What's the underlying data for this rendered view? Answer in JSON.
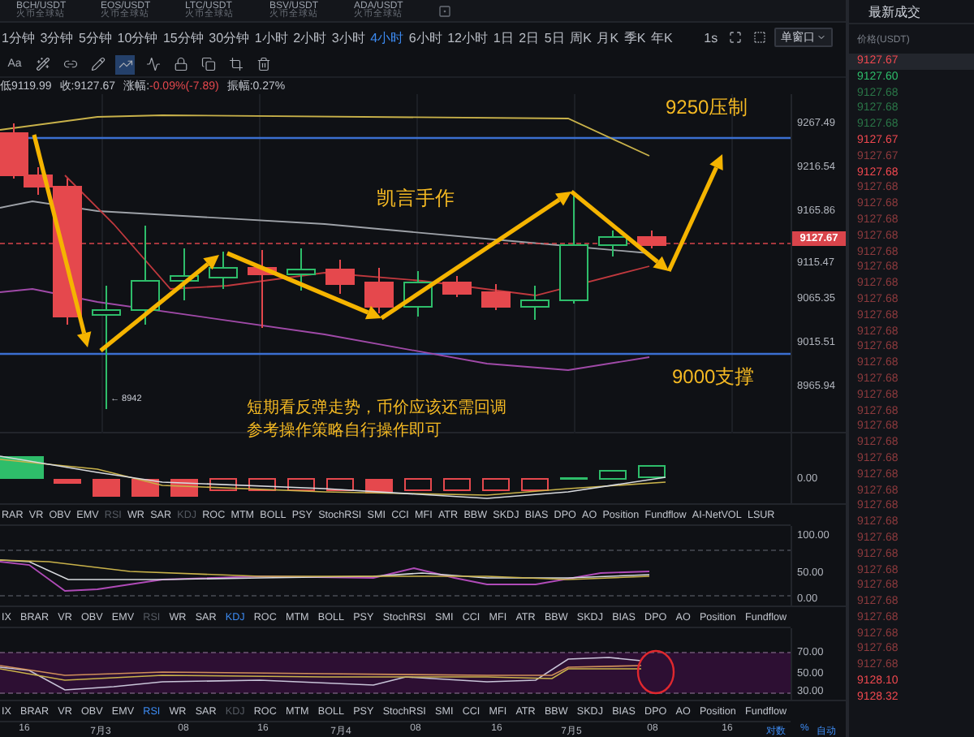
{
  "symbol_tabs": [
    {
      "pair": "BCH/USDT",
      "exchange": "火币全球站"
    },
    {
      "pair": "EOS/USDT",
      "exchange": "火币全球站"
    },
    {
      "pair": "LTC/USDT",
      "exchange": "火币全球站"
    },
    {
      "pair": "BSV/USDT",
      "exchange": "火币全球站"
    },
    {
      "pair": "ADA/USDT",
      "exchange": "火币全球站"
    }
  ],
  "intervals": [
    {
      "label": "1分钟",
      "selected": false
    },
    {
      "label": "3分钟",
      "selected": false
    },
    {
      "label": "5分钟",
      "selected": false
    },
    {
      "label": "10分钟",
      "selected": false
    },
    {
      "label": "15分钟",
      "selected": false
    },
    {
      "label": "30分钟",
      "selected": false
    },
    {
      "label": "1小时",
      "selected": false
    },
    {
      "label": "2小时",
      "selected": false
    },
    {
      "label": "3小时",
      "selected": false
    },
    {
      "label": "4小时",
      "selected": true
    },
    {
      "label": "6小时",
      "selected": false
    },
    {
      "label": "12小时",
      "selected": false
    },
    {
      "label": "1日",
      "selected": false
    },
    {
      "label": "2日",
      "selected": false
    },
    {
      "label": "5日",
      "selected": false
    },
    {
      "label": "周K",
      "selected": false
    },
    {
      "label": "月K",
      "selected": false
    },
    {
      "label": "季K",
      "selected": false
    },
    {
      "label": "年K",
      "selected": false
    }
  ],
  "chart_controls": {
    "tick_label": "1s",
    "window_mode": "单窗口"
  },
  "drawing_tools": [
    {
      "kind": "text",
      "label": "Aa",
      "selected": false
    },
    {
      "kind": "magic",
      "selected": false
    },
    {
      "kind": "link",
      "selected": false
    },
    {
      "kind": "pencil",
      "selected": false
    },
    {
      "kind": "trendline",
      "selected": true
    },
    {
      "kind": "wave",
      "selected": false
    },
    {
      "kind": "lock",
      "selected": false
    },
    {
      "kind": "copy",
      "selected": false
    },
    {
      "kind": "crop",
      "selected": false
    },
    {
      "kind": "trash",
      "selected": false
    }
  ],
  "ohlc_info": [
    {
      "label": "低",
      "value": "9119.99",
      "falling": false
    },
    {
      "label": "收:",
      "value": "9127.67",
      "falling": false
    },
    {
      "label": "涨幅:",
      "value": "-0.09%(-7.89)",
      "falling": true
    },
    {
      "label": "振幅:",
      "value": "0.27%",
      "falling": false
    }
  ],
  "main_chart": {
    "price_labels": [
      "9267.49",
      "9216.54",
      "9165.86",
      "9115.47",
      "9065.35",
      "9015.51",
      "8965.94"
    ],
    "current_price": "9127.67",
    "low_marker": "← 8942",
    "annotations": [
      {
        "kind": "resistance",
        "text": "9250压制"
      },
      {
        "kind": "author",
        "text": "凯言手作"
      },
      {
        "kind": "support",
        "text": "9000支撑"
      },
      {
        "kind": "note",
        "text": "短期看反弹走势，币价应该还需回调"
      },
      {
        "kind": "note",
        "text": "参考操作策略自行操作即可"
      }
    ]
  },
  "volume_panel": {
    "axis_labels": [
      "0.00"
    ]
  },
  "indicator_rows": [
    {
      "items": [
        {
          "label": "RAR",
          "selected": false,
          "muted": false
        },
        {
          "label": "VR",
          "selected": false,
          "muted": false
        },
        {
          "label": "OBV",
          "selected": false,
          "muted": false
        },
        {
          "label": "EMV",
          "selected": false,
          "muted": false
        },
        {
          "label": "RSI",
          "selected": false,
          "muted": true
        },
        {
          "label": "WR",
          "selected": false,
          "muted": false
        },
        {
          "label": "SAR",
          "selected": false,
          "muted": false
        },
        {
          "label": "KDJ",
          "selected": false,
          "muted": true
        },
        {
          "label": "ROC",
          "selected": false,
          "muted": false
        },
        {
          "label": "MTM",
          "selected": false,
          "muted": false
        },
        {
          "label": "BOLL",
          "selected": false,
          "muted": false
        },
        {
          "label": "PSY",
          "selected": false,
          "muted": false
        },
        {
          "label": "StochRSI",
          "selected": false,
          "muted": false
        },
        {
          "label": "SMI",
          "selected": false,
          "muted": false
        },
        {
          "label": "CCI",
          "selected": false,
          "muted": false
        },
        {
          "label": "MFI",
          "selected": false,
          "muted": false
        },
        {
          "label": "ATR",
          "selected": false,
          "muted": false
        },
        {
          "label": "BBW",
          "selected": false,
          "muted": false
        },
        {
          "label": "SKDJ",
          "selected": false,
          "muted": false
        },
        {
          "label": "BIAS",
          "selected": false,
          "muted": false
        },
        {
          "label": "DPO",
          "selected": false,
          "muted": false
        },
        {
          "label": "AO",
          "selected": false,
          "muted": false
        },
        {
          "label": "Position",
          "selected": false,
          "muted": false
        },
        {
          "label": "Fundflow",
          "selected": false,
          "muted": false
        },
        {
          "label": "AI-NetVOL",
          "selected": false,
          "muted": false
        },
        {
          "label": "LSUR",
          "selected": false,
          "muted": false
        }
      ]
    },
    {
      "items": [
        {
          "label": "IX",
          "selected": false,
          "muted": false
        },
        {
          "label": "BRAR",
          "selected": false,
          "muted": false
        },
        {
          "label": "VR",
          "selected": false,
          "muted": false
        },
        {
          "label": "OBV",
          "selected": false,
          "muted": false
        },
        {
          "label": "EMV",
          "selected": false,
          "muted": false
        },
        {
          "label": "RSI",
          "selected": false,
          "muted": true
        },
        {
          "label": "WR",
          "selected": false,
          "muted": false
        },
        {
          "label": "SAR",
          "selected": false,
          "muted": false
        },
        {
          "label": "KDJ",
          "selected": true,
          "muted": false
        },
        {
          "label": "ROC",
          "selected": false,
          "muted": false
        },
        {
          "label": "MTM",
          "selected": false,
          "muted": false
        },
        {
          "label": "BOLL",
          "selected": false,
          "muted": false
        },
        {
          "label": "PSY",
          "selected": false,
          "muted": false
        },
        {
          "label": "StochRSI",
          "selected": false,
          "muted": false
        },
        {
          "label": "SMI",
          "selected": false,
          "muted": false
        },
        {
          "label": "CCI",
          "selected": false,
          "muted": false
        },
        {
          "label": "MFI",
          "selected": false,
          "muted": false
        },
        {
          "label": "ATR",
          "selected": false,
          "muted": false
        },
        {
          "label": "BBW",
          "selected": false,
          "muted": false
        },
        {
          "label": "SKDJ",
          "selected": false,
          "muted": false
        },
        {
          "label": "BIAS",
          "selected": false,
          "muted": false
        },
        {
          "label": "DPO",
          "selected": false,
          "muted": false
        },
        {
          "label": "AO",
          "selected": false,
          "muted": false
        },
        {
          "label": "Position",
          "selected": false,
          "muted": false
        },
        {
          "label": "Fundflow",
          "selected": false,
          "muted": false
        }
      ]
    },
    {
      "items": [
        {
          "label": "IX",
          "selected": false,
          "muted": false
        },
        {
          "label": "BRAR",
          "selected": false,
          "muted": false
        },
        {
          "label": "VR",
          "selected": false,
          "muted": false
        },
        {
          "label": "OBV",
          "selected": false,
          "muted": false
        },
        {
          "label": "EMV",
          "selected": false,
          "muted": false
        },
        {
          "label": "RSI",
          "selected": true,
          "muted": false
        },
        {
          "label": "WR",
          "selected": false,
          "muted": false
        },
        {
          "label": "SAR",
          "selected": false,
          "muted": false
        },
        {
          "label": "KDJ",
          "selected": false,
          "muted": true
        },
        {
          "label": "ROC",
          "selected": false,
          "muted": false
        },
        {
          "label": "MTM",
          "selected": false,
          "muted": false
        },
        {
          "label": "BOLL",
          "selected": false,
          "muted": false
        },
        {
          "label": "PSY",
          "selected": false,
          "muted": false
        },
        {
          "label": "StochRSI",
          "selected": false,
          "muted": false
        },
        {
          "label": "SMI",
          "selected": false,
          "muted": false
        },
        {
          "label": "CCI",
          "selected": false,
          "muted": false
        },
        {
          "label": "MFI",
          "selected": false,
          "muted": false
        },
        {
          "label": "ATR",
          "selected": false,
          "muted": false
        },
        {
          "label": "BBW",
          "selected": false,
          "muted": false
        },
        {
          "label": "SKDJ",
          "selected": false,
          "muted": false
        },
        {
          "label": "BIAS",
          "selected": false,
          "muted": false
        },
        {
          "label": "DPO",
          "selected": false,
          "muted": false
        },
        {
          "label": "AO",
          "selected": false,
          "muted": false
        },
        {
          "label": "Position",
          "selected": false,
          "muted": false
        },
        {
          "label": "Fundflow",
          "selected": false,
          "muted": false
        }
      ]
    }
  ],
  "kdj_panel": {
    "axis_labels": [
      "100.00",
      "50.00",
      "0.00"
    ]
  },
  "rsi_panel": {
    "axis_labels": [
      "70.00",
      "50.00",
      "30.00"
    ]
  },
  "time_axis": {
    "labels": [
      "16",
      "7月3",
      "08",
      "16",
      "7月4",
      "08",
      "16",
      "7月5",
      "08",
      "16"
    ],
    "controls": [
      "对数",
      "%",
      "自动"
    ]
  },
  "trades": {
    "title": "最新成交",
    "column": "价格(USDT)",
    "rows": [
      {
        "price": "9127.67",
        "buy": false,
        "bright": true,
        "selected": true
      },
      {
        "price": "9127.60",
        "buy": true,
        "bright": true,
        "selected": false
      },
      {
        "price": "9127.68",
        "buy": true,
        "bright": false,
        "selected": false
      },
      {
        "price": "9127.68",
        "buy": true,
        "bright": false,
        "selected": false
      },
      {
        "price": "9127.68",
        "buy": true,
        "bright": false,
        "selected": false
      },
      {
        "price": "9127.67",
        "buy": false,
        "bright": true,
        "selected": false
      },
      {
        "price": "9127.67",
        "buy": false,
        "bright": false,
        "selected": false
      },
      {
        "price": "9127.68",
        "buy": false,
        "bright": true,
        "selected": false
      },
      {
        "price": "9127.68",
        "buy": false,
        "bright": false,
        "selected": false
      },
      {
        "price": "9127.68",
        "buy": false,
        "bright": false,
        "selected": false
      },
      {
        "price": "9127.68",
        "buy": false,
        "bright": false,
        "selected": false
      },
      {
        "price": "9127.68",
        "buy": false,
        "bright": false,
        "selected": false
      },
      {
        "price": "9127.68",
        "buy": false,
        "bright": false,
        "selected": false
      },
      {
        "price": "9127.68",
        "buy": false,
        "bright": false,
        "selected": false
      },
      {
        "price": "9127.68",
        "buy": false,
        "bright": false,
        "selected": false
      },
      {
        "price": "9127.68",
        "buy": false,
        "bright": false,
        "selected": false
      },
      {
        "price": "9127.68",
        "buy": false,
        "bright": false,
        "selected": false
      },
      {
        "price": "9127.68",
        "buy": false,
        "bright": false,
        "selected": false
      },
      {
        "price": "9127.68",
        "buy": false,
        "bright": false,
        "selected": false
      },
      {
        "price": "9127.68",
        "buy": false,
        "bright": false,
        "selected": false
      },
      {
        "price": "9127.68",
        "buy": false,
        "bright": false,
        "selected": false
      },
      {
        "price": "9127.68",
        "buy": false,
        "bright": false,
        "selected": false
      },
      {
        "price": "9127.68",
        "buy": false,
        "bright": false,
        "selected": false
      },
      {
        "price": "9127.68",
        "buy": false,
        "bright": false,
        "selected": false
      },
      {
        "price": "9127.68",
        "buy": false,
        "bright": false,
        "selected": false
      },
      {
        "price": "9127.68",
        "buy": false,
        "bright": false,
        "selected": false
      },
      {
        "price": "9127.68",
        "buy": false,
        "bright": false,
        "selected": false
      },
      {
        "price": "9127.68",
        "buy": false,
        "bright": false,
        "selected": false
      },
      {
        "price": "9127.68",
        "buy": false,
        "bright": false,
        "selected": false
      },
      {
        "price": "9127.68",
        "buy": false,
        "bright": false,
        "selected": false
      },
      {
        "price": "9127.68",
        "buy": false,
        "bright": false,
        "selected": false
      },
      {
        "price": "9127.68",
        "buy": false,
        "bright": false,
        "selected": false
      },
      {
        "price": "9127.68",
        "buy": false,
        "bright": false,
        "selected": false
      },
      {
        "price": "9127.68",
        "buy": false,
        "bright": false,
        "selected": false
      },
      {
        "price": "9127.68",
        "buy": false,
        "bright": false,
        "selected": false
      },
      {
        "price": "9127.68",
        "buy": false,
        "bright": false,
        "selected": false
      },
      {
        "price": "9127.68",
        "buy": false,
        "bright": false,
        "selected": false
      },
      {
        "price": "9127.68",
        "buy": false,
        "bright": false,
        "selected": false
      },
      {
        "price": "9127.68",
        "buy": false,
        "bright": false,
        "selected": false
      },
      {
        "price": "9128.10",
        "buy": false,
        "bright": true,
        "selected": false
      },
      {
        "price": "9128.32",
        "buy": false,
        "bright": true,
        "selected": false
      }
    ]
  }
}
